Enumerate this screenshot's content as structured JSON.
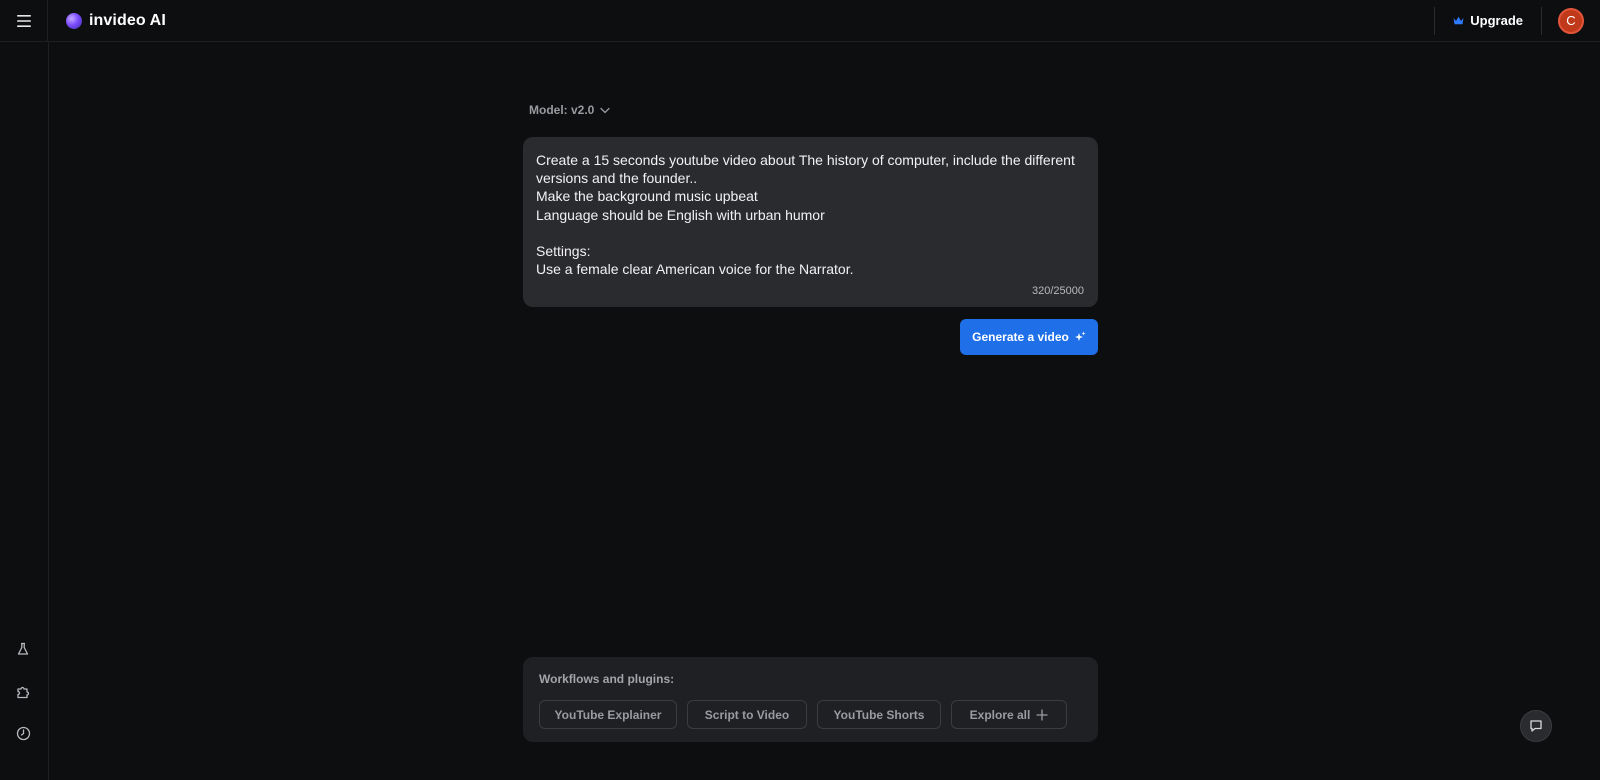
{
  "app": {
    "name": "invideo AI"
  },
  "header": {
    "upgrade_label": "Upgrade",
    "avatar_initial": "C"
  },
  "model": {
    "label": "Model: v2.0"
  },
  "prompt": {
    "text": "Create a 15 seconds youtube video about The history of computer, include the different versions and the founder..\nMake the background music upbeat\nLanguage should be English with urban humor\n\nSettings:\nUse a female clear American voice for the Narrator.",
    "char_count": "320/25000"
  },
  "generate": {
    "label": "Generate a video"
  },
  "workflows": {
    "title": "Workflows and plugins:",
    "chips": [
      {
        "label": "YouTube Explainer"
      },
      {
        "label": "Script to Video"
      },
      {
        "label": "YouTube Shorts"
      },
      {
        "label": "Explore all"
      }
    ]
  },
  "colors": {
    "background": "#0d0e10",
    "accent": "#1f6fe8",
    "avatar": "#c0391b",
    "upgrade_crown": "#2f7bff"
  },
  "icons": {
    "menu": "hamburger-icon",
    "upgrade": "crown-icon",
    "sidebar": [
      "flask-icon",
      "puzzle-icon",
      "history-icon"
    ],
    "generate": "sparkle-icon",
    "model": "chevron-down-icon",
    "explore": "plus-icon",
    "chat": "chat-icon"
  }
}
